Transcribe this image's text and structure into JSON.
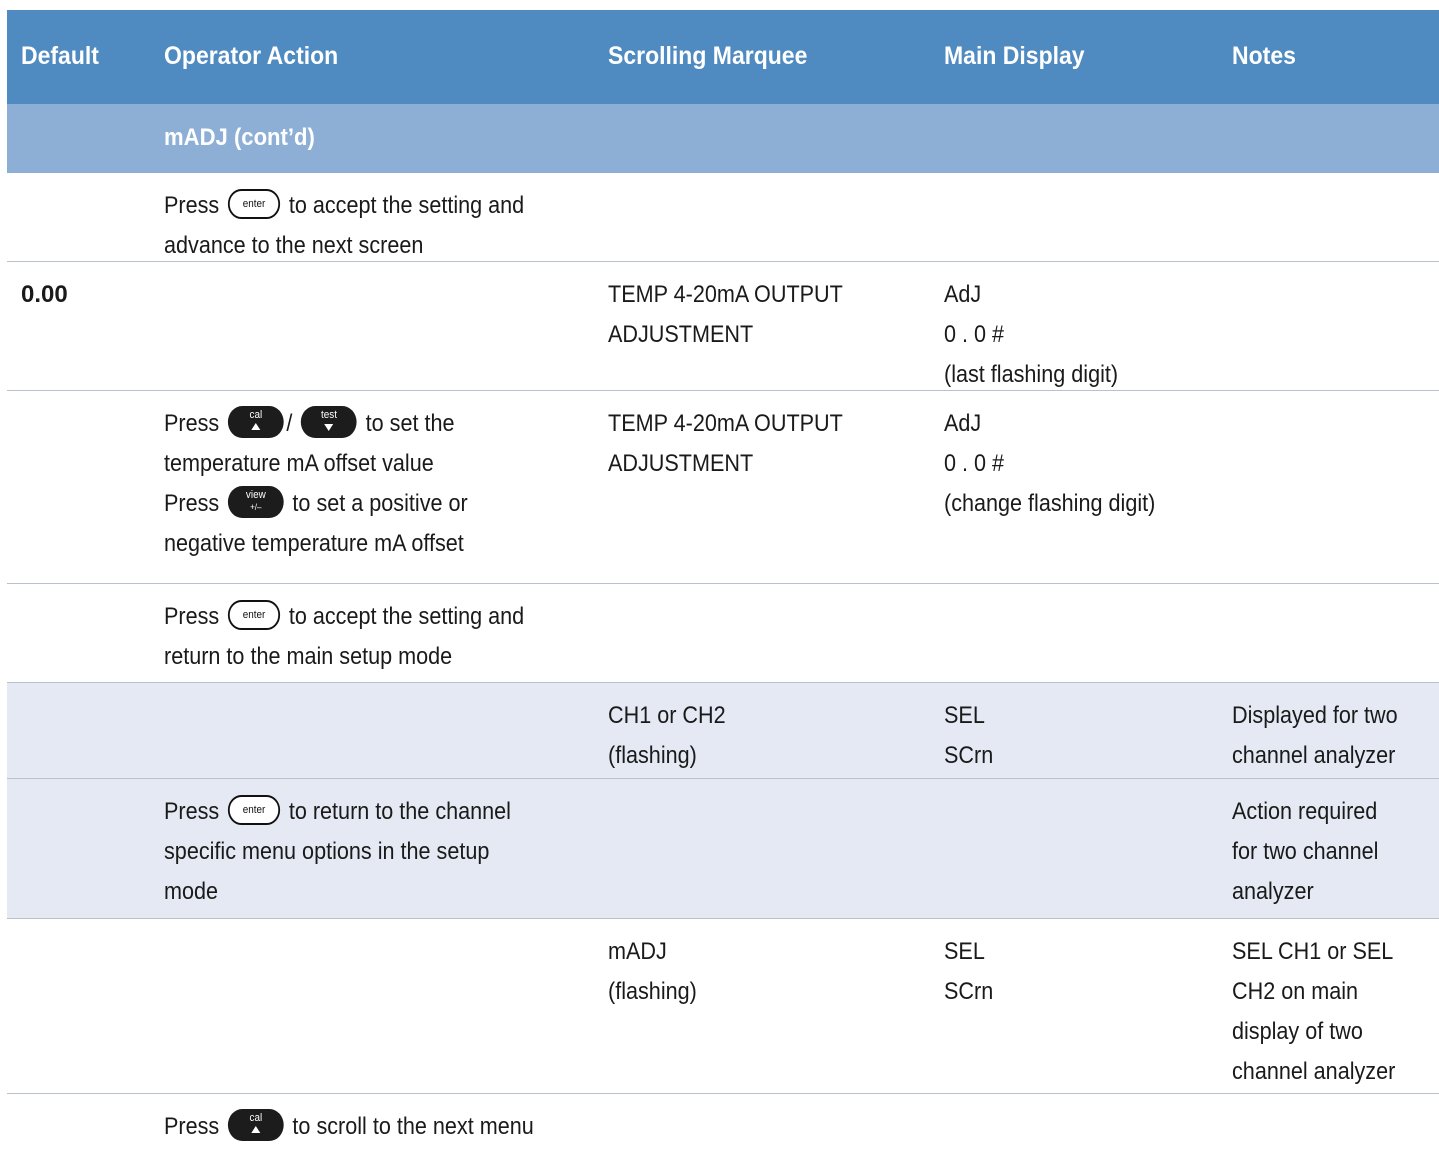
{
  "header": {
    "default": "Default",
    "operator_action": "Operator Action",
    "scrolling_marquee": "Scrolling Marquee",
    "main_display": "Main Display",
    "notes": "Notes"
  },
  "section": {
    "title": "mADJ (cont’d)"
  },
  "keys": {
    "enter": "enter",
    "cal": "cal",
    "test": "test",
    "view": "view",
    "plus_minus": "+/–"
  },
  "rows": [
    {
      "default": "",
      "op": {
        "before": "Press",
        "after": "to accept the setting and",
        "line2": "advance to the next screen"
      },
      "marquee": [],
      "display": [],
      "notes": []
    },
    {
      "default": "0.00",
      "marquee": [
        "TEMP 4-20mA OUTPUT",
        "ADJUSTMENT"
      ],
      "display": [
        "AdJ",
        "0 . 0 #",
        "(last flashing digit)"
      ],
      "notes": []
    },
    {
      "op": {
        "before": "Press",
        "slash": "/",
        "after": "to set the",
        "line2": "temperature mA offset value",
        "line3_before": "Press",
        "line3_after": "to set a positive or",
        "line4": "negative temperature mA offset"
      },
      "marquee": [
        "TEMP 4-20mA OUTPUT",
        "ADJUSTMENT"
      ],
      "display": [
        "AdJ",
        "0 . 0 #",
        "(change flashing digit)"
      ]
    },
    {
      "op": {
        "before": "Press",
        "after": "to accept the setting and",
        "line2": "return to the main setup mode"
      }
    },
    {
      "marquee": [
        "CH1 or CH2",
        "(flashing)"
      ],
      "display": [
        "SEL",
        "SCrn"
      ],
      "notes": [
        "Displayed for two",
        "channel analyzer"
      ]
    },
    {
      "op": {
        "before": "Press",
        "after": "to return to the channel",
        "line2": "specific menu options in the setup",
        "line3": "mode"
      },
      "notes": [
        "Action required",
        "for two channel",
        "analyzer"
      ]
    },
    {
      "marquee": [
        "mADJ",
        "(flashing)"
      ],
      "display": [
        "SEL",
        "SCrn"
      ],
      "notes": [
        "SEL CH1 or SEL",
        "CH2 on main",
        "display of two",
        "channel analyzer"
      ]
    },
    {
      "op": {
        "before": "Press",
        "after": "to scroll to the next menu"
      }
    }
  ]
}
